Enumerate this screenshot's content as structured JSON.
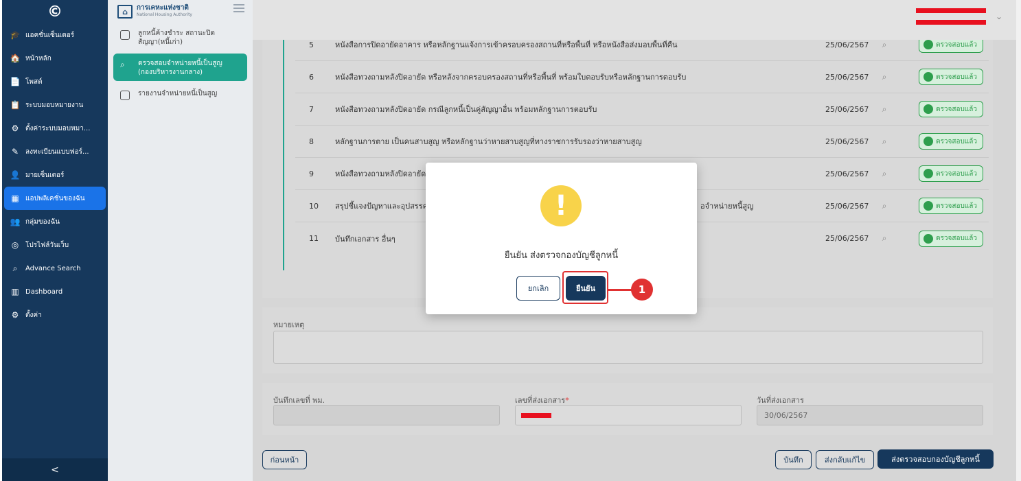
{
  "nav": {
    "logo": "©",
    "items": [
      {
        "icon": "🎓",
        "label": "แอคชั่นเซ็นเตอร์"
      },
      {
        "icon": "🏠",
        "label": "หน้าหลัก"
      },
      {
        "icon": "📄",
        "label": "โพสต์"
      },
      {
        "icon": "📋",
        "label": "ระบบมอบหมายงาน"
      },
      {
        "icon": "⚙",
        "label": "ตั้งค่าระบบมอบหมา..."
      },
      {
        "icon": "✎",
        "label": "ลงทะเบียนแบบฟอร์..."
      },
      {
        "icon": "👤",
        "label": "มายเซ็นเตอร์"
      },
      {
        "icon": "▦",
        "label": "แอปพลิเคชั่นของฉัน"
      },
      {
        "icon": "👥",
        "label": "กลุ่มของฉัน"
      },
      {
        "icon": "◎",
        "label": "โปรไฟล์วันเว็บ"
      },
      {
        "icon": "⌕",
        "label": "Advance Search"
      },
      {
        "icon": "▥",
        "label": "Dashboard"
      },
      {
        "icon": "⚙",
        "label": "ตั้งค่า"
      }
    ],
    "collapse": "<"
  },
  "subnav": {
    "brand_th": "การเคหะแห่งชาติ",
    "brand_en": "National Housing Authority",
    "items": [
      {
        "label": "ลูกหนี้ค้างชำระ สถานะปิดสัญญา(หนี้เก่า)"
      },
      {
        "label": "ตรวจสอบจำหน่ายหนี้เป็นสูญ (กองบริหารงานกลาง)"
      },
      {
        "label": "รายงานจำหน่ายหนี้เป็นสูญ"
      }
    ]
  },
  "documents": [
    {
      "num": "5",
      "name": "หนังสือการปิดอายัดอาคาร หรือหลักฐานแจ้งการเข้าครอบครองสถานที่หรือพื้นที่ หรือหนังสือส่งมอบพื้นที่คืน",
      "date": "25/06/2567",
      "status": "ตรวจสอบแล้ว"
    },
    {
      "num": "6",
      "name": "หนังสือทวงถามหลังปิดอายัด หรือหลังจากครอบครองสถานที่หรือพื้นที่ พร้อมใบตอบรับหรือหลักฐานการตอบรับ",
      "date": "25/06/2567",
      "status": "ตรวจสอบแล้ว"
    },
    {
      "num": "7",
      "name": "หนังสือทวงถามหลังปิดอายัด กรณีลูกหนี้เป็นคู่สัญญาอื่น พร้อมหลักฐานการตอบรับ",
      "date": "25/06/2567",
      "status": "ตรวจสอบแล้ว"
    },
    {
      "num": "8",
      "name": "หลักฐานการตาย เป็นคนสาบสูญ หรือหลักฐานว่าหายสาบสูญที่ทางราชการรับรองว่าหายสาบสูญ",
      "date": "25/06/2567",
      "status": "ตรวจสอบแล้ว"
    },
    {
      "num": "9",
      "name": "หนังสือทวงถามหลังปิดอายัด",
      "date": "25/06/2567",
      "status": "ตรวจสอบแล้ว"
    },
    {
      "num": "10",
      "name": "สรุปชี้แจงปัญหาและอุปสรรค",
      "name_tail": "อจำหน่ายหนี้สูญ",
      "date": "25/06/2567",
      "status": "ตรวจสอบแล้ว"
    },
    {
      "num": "11",
      "name": "บันทึกเอกสาร อื่นๆ",
      "date": "25/06/2567",
      "status": "ตรวจสอบแล้ว"
    }
  ],
  "form": {
    "note_label": "หมายเหตุ",
    "memo_label": "บันทึกเลขที่ พม.",
    "docno_label": "เลขที่ส่งเอกสาร",
    "required_mark": "*",
    "date_label": "วันที่ส่งเอกสาร",
    "date_value": "30/06/2567"
  },
  "actions": {
    "back": "ก่อนหน้า",
    "save": "บันทึก",
    "return": "ส่งกลับแก้ไข",
    "submit": "ส่งตรวจสอบกองบัญชีลูกหนี้"
  },
  "modal": {
    "icon": "!",
    "message": "ยืนยัน ส่งตรวจกองบัญชีลูกหนี้",
    "cancel": "ยกเลิก",
    "confirm": "ยืนยัน",
    "step": "1"
  },
  "colors": {
    "nav_bg": "#16385c",
    "accent_teal": "#1fa38e",
    "status_green": "#2e9e4d",
    "highlight_red": "#e03131",
    "warning_yellow": "#f8d34a"
  }
}
